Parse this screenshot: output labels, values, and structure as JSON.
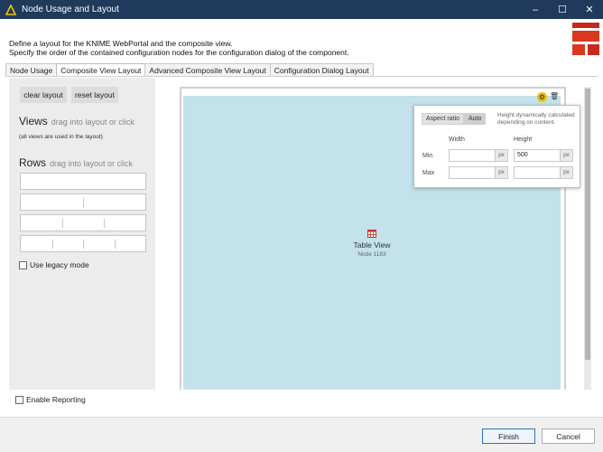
{
  "window": {
    "title": "Node Usage and Layout",
    "controls": {
      "minimize": "–",
      "maximize": "☐",
      "close": "✕"
    }
  },
  "description": {
    "line1": "Define a layout for the KNIME WebPortal and the composite view.",
    "line2": "Specify the order of the contained configuration nodes for the configuration dialog of the component."
  },
  "tabs": [
    {
      "label": "Node Usage",
      "active": false
    },
    {
      "label": "Composite View Layout",
      "active": true
    },
    {
      "label": "Advanced Composite View Layout",
      "active": false
    },
    {
      "label": "Configuration Dialog Layout",
      "active": false
    }
  ],
  "left_panel": {
    "clear_layout": "clear layout",
    "reset_layout": "reset layout",
    "views_heading": "Views",
    "views_hint": "drag into layout or click",
    "views_note": "(all views are used in the layout)",
    "rows_heading": "Rows",
    "rows_hint": "drag into layout or click",
    "legacy_mode": "Use legacy mode"
  },
  "view": {
    "name": "Table View",
    "node": "Node 1183",
    "icon": "table-icon"
  },
  "popover": {
    "aspect_ratio": "Aspect ratio",
    "auto": "Auto",
    "note": "Height dynamically calculated depending on content.",
    "width_label": "Width",
    "height_label": "Height",
    "min_label": "Min",
    "max_label": "Max",
    "unit": "px",
    "min_width": "",
    "min_height": "500",
    "max_width": "",
    "max_height": ""
  },
  "enable_reporting": "Enable Reporting",
  "footer": {
    "finish": "Finish",
    "cancel": "Cancel"
  },
  "colors": {
    "titlebar": "#1f3a5a",
    "view_fill": "#c3e2ec",
    "gear": "#f2c200",
    "primary_border": "#2a6fbf"
  }
}
